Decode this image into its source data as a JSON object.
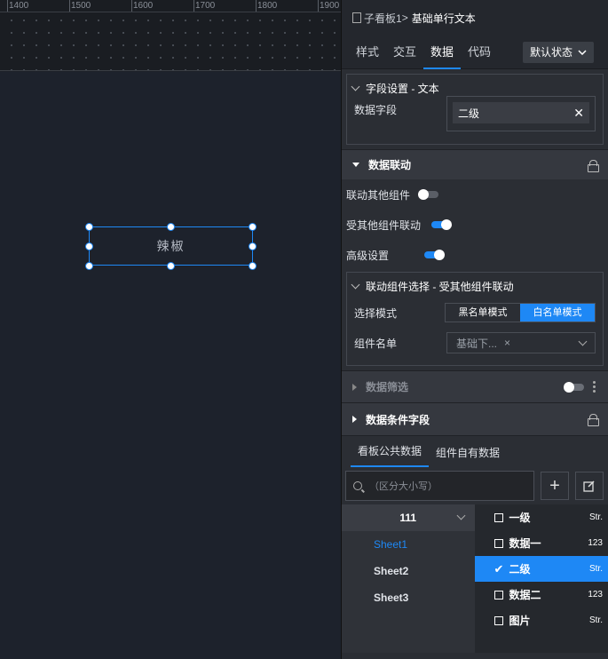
{
  "ruler": {
    "labels": [
      "1400",
      "1500",
      "1600",
      "1700",
      "1800",
      "1900"
    ]
  },
  "canvas": {
    "widget_text": "辣椒"
  },
  "breadcrumb": {
    "parent": "子看板1",
    "separator": ">",
    "current": "基础单行文本"
  },
  "tabs": [
    {
      "label": "样式",
      "active": false
    },
    {
      "label": "交互",
      "active": false
    },
    {
      "label": "数据",
      "active": true
    },
    {
      "label": "代码",
      "active": false
    }
  ],
  "state_select": {
    "value": "默认状态"
  },
  "field_setting": {
    "title": "字段设置 - 文本",
    "label": "数据字段",
    "value": "二级"
  },
  "data_link": {
    "title": "数据联动",
    "link_others": {
      "label": "联动其他组件",
      "on": false
    },
    "linked_by_others": {
      "label": "受其他组件联动",
      "on": true
    },
    "advanced": {
      "label": "高级设置",
      "on": true
    }
  },
  "link_select": {
    "title": "联动组件选择 - 受其他组件联动",
    "mode_label": "选择模式",
    "mode_options": [
      "黑名单模式",
      "白名单模式"
    ],
    "mode_selected": "白名单模式",
    "list_label": "组件名单",
    "list_chip": "基础下...",
    "chip_remove": "×"
  },
  "data_filter": {
    "title": "数据筛选",
    "on": false
  },
  "data_condition": {
    "title": "数据条件字段"
  },
  "data_tabs": [
    {
      "label": "看板公共数据",
      "active": true
    },
    {
      "label": "组件自有数据",
      "active": false
    }
  ],
  "search": {
    "placeholder": "（区分大小写）"
  },
  "datasets": {
    "group": "111",
    "sheets": [
      {
        "label": "Sheet1",
        "active": true
      },
      {
        "label": "Sheet2",
        "active": false
      },
      {
        "label": "Sheet3",
        "active": false
      }
    ]
  },
  "fields": [
    {
      "label": "一级",
      "type": "Str.",
      "selected": false
    },
    {
      "label": "数据一",
      "type": "123",
      "selected": false
    },
    {
      "label": "二级",
      "type": "Str.",
      "selected": true
    },
    {
      "label": "数据二",
      "type": "123",
      "selected": false
    },
    {
      "label": "图片",
      "type": "Str.",
      "selected": false
    }
  ],
  "colors": {
    "accent": "#1e88f5",
    "panel": "#2b2e34",
    "canvas": "#1d222c"
  }
}
